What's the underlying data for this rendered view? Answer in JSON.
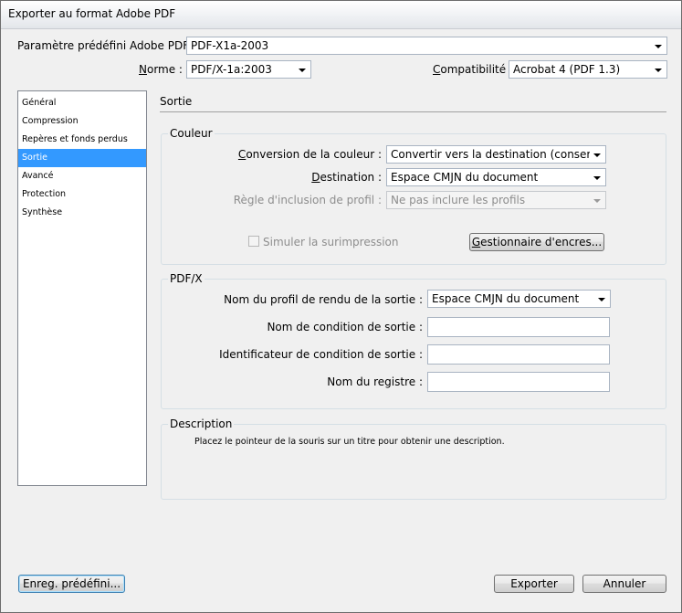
{
  "window": {
    "title": "Exporter au format Adobe PDF"
  },
  "header": {
    "preset_label_pre": "Paramètre prédéfini Adobe PDF :",
    "preset_value": "PDF-X1a-2003",
    "norme_label_u": "N",
    "norme_label_rest": "orme  :",
    "norme_value": "PDF/X-1a:2003",
    "compat_label_u": "C",
    "compat_label_rest": "ompatibilité  :",
    "compat_value": "Acrobat 4 (PDF 1.3)"
  },
  "sidebar": {
    "items": [
      {
        "label": "Général"
      },
      {
        "label": "Compression"
      },
      {
        "label": "Repères et fonds perdus"
      },
      {
        "label": "Sortie"
      },
      {
        "label": "Avancé"
      },
      {
        "label": "Protection"
      },
      {
        "label": "Synthèse"
      }
    ],
    "active_index": 3
  },
  "main": {
    "section_title": "Sortie",
    "couleur": {
      "title": "Couleur",
      "conversion_label_u": "C",
      "conversion_label_rest": "onversion de la couleur :",
      "conversion_value": "Convertir vers la destination (conserver",
      "destination_label_u": "D",
      "destination_label_rest": "estination :",
      "destination_value": "Espace CMJN du document",
      "inclusion_label": "Règle d'inclusion de profil :",
      "inclusion_value": "Ne pas inclure les profils",
      "simuler_label": "Simuler la surimpression",
      "simuler_checked": false,
      "encres_button_u": "G",
      "encres_button_rest": "estionnaire d'encres..."
    },
    "pdfx": {
      "title": "PDF/X",
      "profil_label": "Nom du profil de rendu de la sortie :",
      "profil_value": "Espace CMJN du document",
      "condition_label": "Nom de condition de sortie :",
      "condition_value": "",
      "identificateur_label": "Identificateur de condition de sortie :",
      "identificateur_value": "",
      "registre_label": "Nom du registre :",
      "registre_value": ""
    },
    "description": {
      "title": "Description",
      "text": "Placez le pointeur de la souris sur un titre pour obtenir une description."
    }
  },
  "footer": {
    "enreg_button": "Enreg. prédéfini...",
    "exporter_button": "Exporter",
    "annuler_button": "Annuler"
  },
  "colors": {
    "selection": "#3399ff",
    "group_border": "#d5dfe5"
  }
}
